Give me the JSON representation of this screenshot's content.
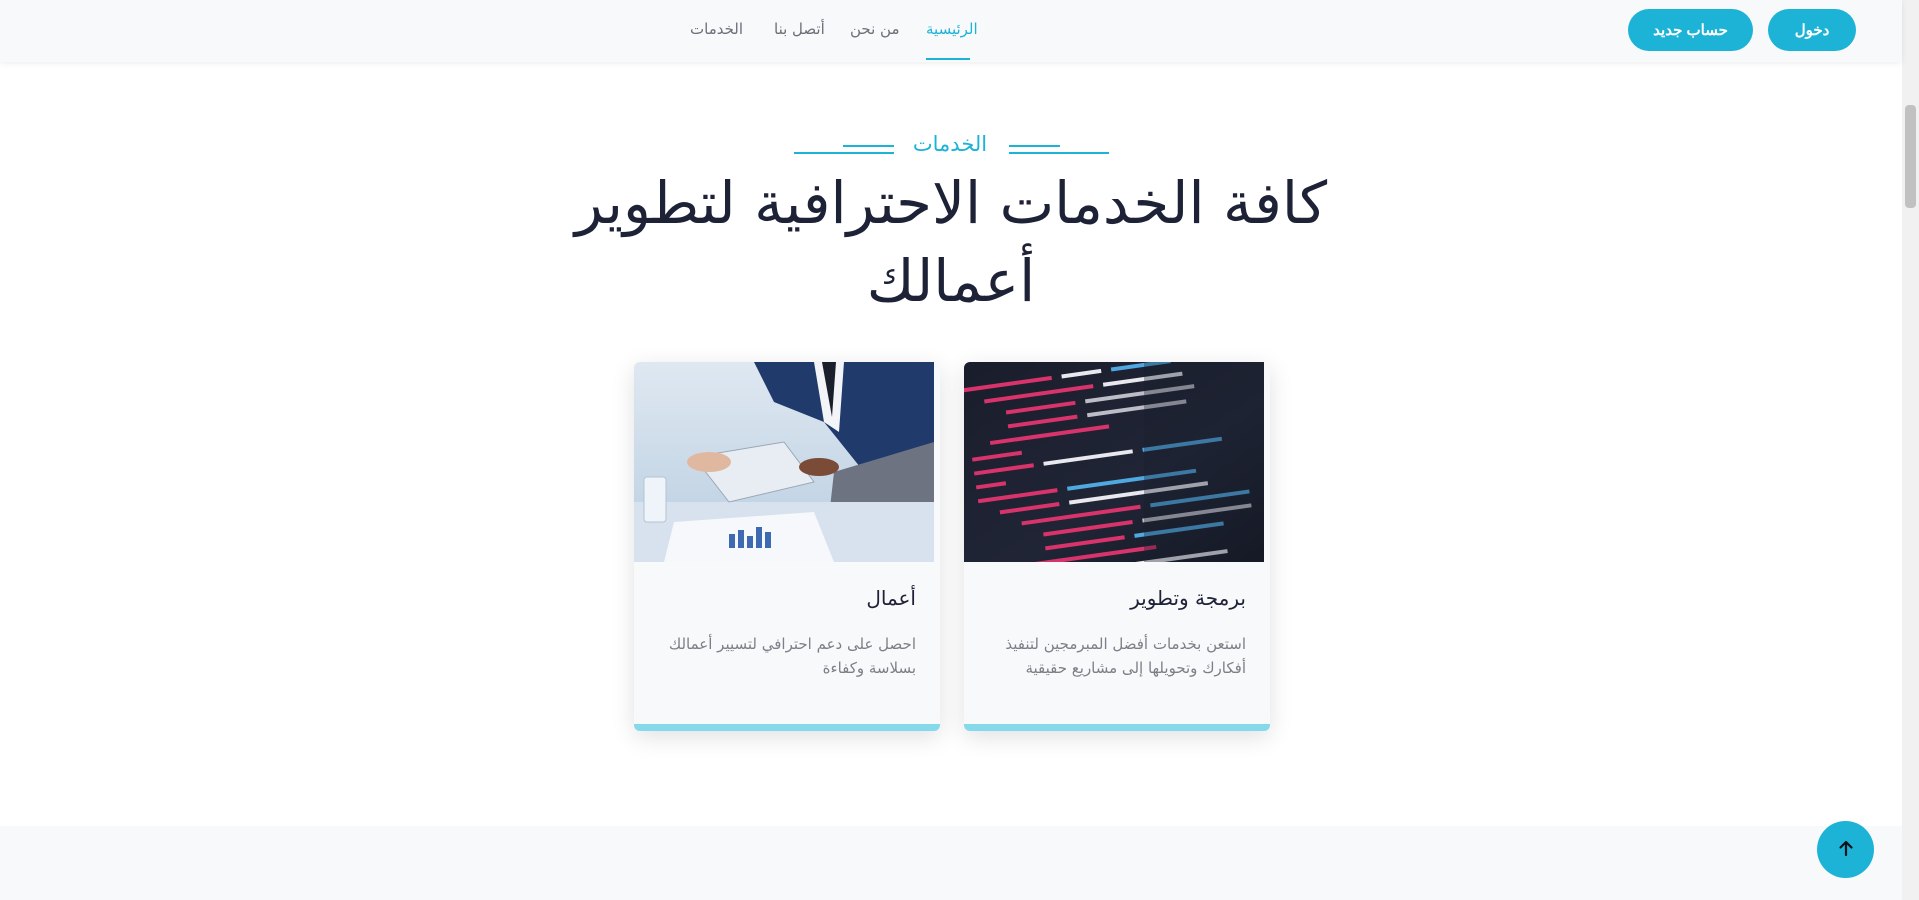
{
  "header": {
    "nav": [
      {
        "label": "الرئيسية",
        "active": true
      },
      {
        "label": "من نحن",
        "active": false
      },
      {
        "label": "أتصل بنا",
        "active": false
      },
      {
        "label": "الخدمات",
        "active": false
      }
    ],
    "login_label": "دخول",
    "register_label": "حساب جديد"
  },
  "services": {
    "eyebrow": "الخدمات",
    "title": "كافة الخدمات الاحترافية لتطوير أعمالك",
    "cards": [
      {
        "title": "برمجة وتطوير",
        "text": "استعن بخدمات أفضل المبرمجين لتنفيذ أفكارك وتحويلها إلى مشاريع حقيقية",
        "image": "code-screen-image"
      },
      {
        "title": "أعمال",
        "text": "احصل على دعم احترافي لتسيير أعمالك بسلاسة وكفاءة",
        "image": "business-meeting-image"
      }
    ]
  },
  "back_to_top_icon": "arrow-up-icon",
  "colors": {
    "accent": "#1cb3d6",
    "card_bar": "#86d9ea",
    "title": "#1e2237",
    "muted": "#7c7f87"
  }
}
